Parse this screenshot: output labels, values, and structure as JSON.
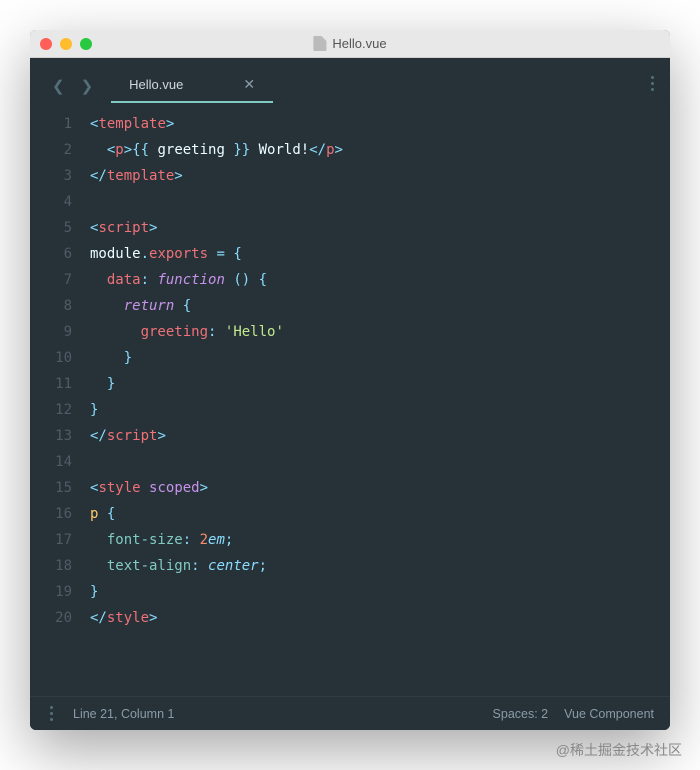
{
  "window": {
    "title": "Hello.vue"
  },
  "tabs": {
    "active": {
      "name": "Hello.vue"
    }
  },
  "code": {
    "lines": [
      [
        {
          "c": "tok-bracket",
          "t": "<"
        },
        {
          "c": "tok-tag",
          "t": "template"
        },
        {
          "c": "tok-bracket",
          "t": ">"
        }
      ],
      [
        {
          "c": "",
          "t": "  "
        },
        {
          "c": "tok-bracket",
          "t": "<"
        },
        {
          "c": "tok-tag",
          "t": "p"
        },
        {
          "c": "tok-bracket",
          "t": ">"
        },
        {
          "c": "tok-punct",
          "t": "{{"
        },
        {
          "c": "tok-text",
          "t": " greeting "
        },
        {
          "c": "tok-punct",
          "t": "}}"
        },
        {
          "c": "tok-text",
          "t": " World!"
        },
        {
          "c": "tok-bracket",
          "t": "</"
        },
        {
          "c": "tok-tag",
          "t": "p"
        },
        {
          "c": "tok-bracket",
          "t": ">"
        }
      ],
      [
        {
          "c": "tok-bracket",
          "t": "</"
        },
        {
          "c": "tok-tag",
          "t": "template"
        },
        {
          "c": "tok-bracket",
          "t": ">"
        }
      ],
      [],
      [
        {
          "c": "tok-bracket",
          "t": "<"
        },
        {
          "c": "tok-tag",
          "t": "script"
        },
        {
          "c": "tok-bracket",
          "t": ">"
        }
      ],
      [
        {
          "c": "tok-ident",
          "t": "module"
        },
        {
          "c": "tok-punct",
          "t": "."
        },
        {
          "c": "tok-prop",
          "t": "exports"
        },
        {
          "c": "tok-text",
          "t": " "
        },
        {
          "c": "tok-punct",
          "t": "="
        },
        {
          "c": "tok-text",
          "t": " "
        },
        {
          "c": "tok-punct",
          "t": "{"
        }
      ],
      [
        {
          "c": "",
          "t": "  "
        },
        {
          "c": "tok-prop",
          "t": "data"
        },
        {
          "c": "tok-punct",
          "t": ":"
        },
        {
          "c": "tok-text",
          "t": " "
        },
        {
          "c": "tok-kw",
          "t": "function"
        },
        {
          "c": "tok-text",
          "t": " "
        },
        {
          "c": "tok-punct",
          "t": "()"
        },
        {
          "c": "tok-text",
          "t": " "
        },
        {
          "c": "tok-punct",
          "t": "{"
        }
      ],
      [
        {
          "c": "",
          "t": "    "
        },
        {
          "c": "tok-kw",
          "t": "return"
        },
        {
          "c": "tok-text",
          "t": " "
        },
        {
          "c": "tok-punct",
          "t": "{"
        }
      ],
      [
        {
          "c": "",
          "t": "      "
        },
        {
          "c": "tok-prop",
          "t": "greeting"
        },
        {
          "c": "tok-punct",
          "t": ":"
        },
        {
          "c": "tok-text",
          "t": " "
        },
        {
          "c": "tok-str",
          "t": "'Hello'"
        }
      ],
      [
        {
          "c": "",
          "t": "    "
        },
        {
          "c": "tok-punct",
          "t": "}"
        }
      ],
      [
        {
          "c": "",
          "t": "  "
        },
        {
          "c": "tok-punct",
          "t": "}"
        }
      ],
      [
        {
          "c": "tok-punct",
          "t": "}"
        }
      ],
      [
        {
          "c": "tok-bracket",
          "t": "</"
        },
        {
          "c": "tok-tag",
          "t": "script"
        },
        {
          "c": "tok-bracket",
          "t": ">"
        }
      ],
      [],
      [
        {
          "c": "tok-bracket",
          "t": "<"
        },
        {
          "c": "tok-tag",
          "t": "style"
        },
        {
          "c": "tok-text",
          "t": " "
        },
        {
          "c": "tok-attr",
          "t": "scoped"
        },
        {
          "c": "tok-bracket",
          "t": ">"
        }
      ],
      [
        {
          "c": "tok-sel",
          "t": "p"
        },
        {
          "c": "tok-text",
          "t": " "
        },
        {
          "c": "tok-punct",
          "t": "{"
        }
      ],
      [
        {
          "c": "",
          "t": "  "
        },
        {
          "c": "tok-css-prop",
          "t": "font-size"
        },
        {
          "c": "tok-punct",
          "t": ":"
        },
        {
          "c": "tok-text",
          "t": " "
        },
        {
          "c": "tok-num",
          "t": "2"
        },
        {
          "c": "tok-css-key",
          "t": "em"
        },
        {
          "c": "tok-punct",
          "t": ";"
        }
      ],
      [
        {
          "c": "",
          "t": "  "
        },
        {
          "c": "tok-css-prop",
          "t": "text-align"
        },
        {
          "c": "tok-punct",
          "t": ":"
        },
        {
          "c": "tok-text",
          "t": " "
        },
        {
          "c": "tok-css-key",
          "t": "center"
        },
        {
          "c": "tok-punct",
          "t": ";"
        }
      ],
      [
        {
          "c": "tok-punct",
          "t": "}"
        }
      ],
      [
        {
          "c": "tok-bracket",
          "t": "</"
        },
        {
          "c": "tok-tag",
          "t": "style"
        },
        {
          "c": "tok-bracket",
          "t": ">"
        }
      ]
    ]
  },
  "status": {
    "position": "Line 21, Column 1",
    "spaces": "Spaces: 2",
    "mode": "Vue Component"
  },
  "watermark": "@稀土掘金技术社区"
}
